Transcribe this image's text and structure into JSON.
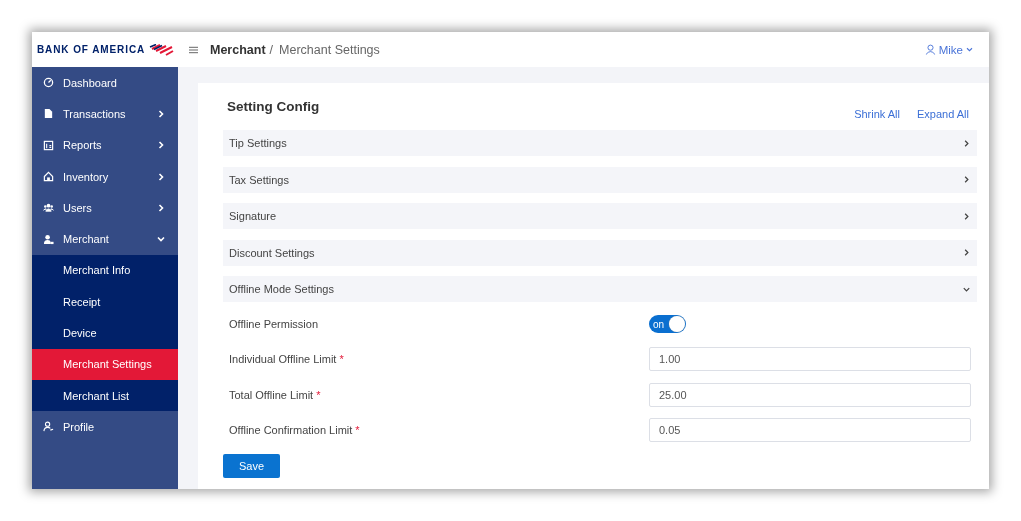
{
  "brand": {
    "name": "BANK OF AMERICA"
  },
  "sidebar": {
    "items": [
      {
        "label": "Dashboard",
        "selected": false
      },
      {
        "label": "Transactions",
        "selected": false,
        "expanded": false
      },
      {
        "label": "Reports",
        "selected": false,
        "expanded": false
      },
      {
        "label": "Inventory",
        "selected": false,
        "expanded": false
      },
      {
        "label": "Users",
        "selected": false,
        "expanded": false
      },
      {
        "label": "Merchant",
        "selected": false,
        "expanded": true,
        "children": [
          {
            "label": "Merchant Info",
            "selected": false
          },
          {
            "label": "Receipt",
            "selected": false
          },
          {
            "label": "Device",
            "selected": false
          },
          {
            "label": "Merchant Settings",
            "selected": true
          },
          {
            "label": "Merchant List",
            "selected": false
          }
        ]
      },
      {
        "label": "Profile",
        "selected": false
      }
    ]
  },
  "header": {
    "breadcrumb": [
      "Merchant",
      "Merchant Settings"
    ],
    "separator": "/",
    "user": "Mike"
  },
  "content": {
    "title": "Setting Config",
    "actions": [
      "Shrink All",
      "Expand All"
    ],
    "sections": [
      {
        "title": "Tip Settings",
        "expanded": false
      },
      {
        "title": "Tax Settings",
        "expanded": false
      },
      {
        "title": "Signature",
        "expanded": false
      },
      {
        "title": "Discount Settings",
        "expanded": false
      },
      {
        "title": "Offline Mode Settings",
        "expanded": true,
        "fields": [
          {
            "kind": "toggle",
            "label": "Offline Permission",
            "on": true,
            "toggle_text": "on"
          },
          {
            "kind": "input",
            "label": "Individual Offline Limit",
            "required_mark": "*",
            "value": "1.00"
          },
          {
            "kind": "input",
            "label": "Total Offline Limit",
            "required_mark": "*",
            "value": "25.00"
          },
          {
            "kind": "input",
            "label": "Offline Confirmation Limit",
            "required_mark": "*",
            "value": "0.05"
          }
        ]
      }
    ]
  },
  "save_button": "Save"
}
